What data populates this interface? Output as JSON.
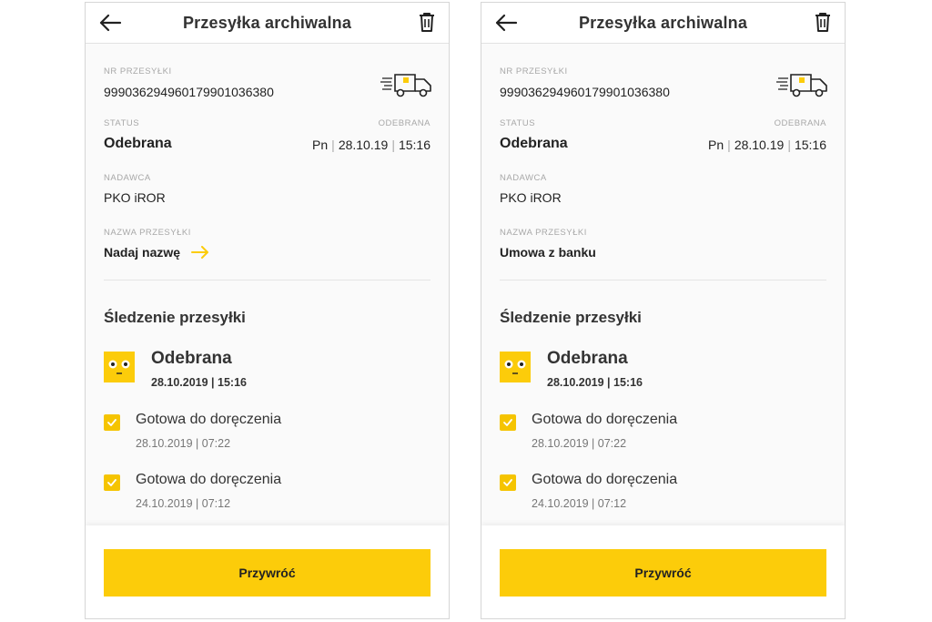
{
  "accent_color": "#fccc0a",
  "icons": [
    "back-arrow-icon",
    "trash-icon",
    "delivery-truck-icon",
    "arrow-right-icon",
    "robot-face-icon",
    "checkbox-check-icon"
  ],
  "screens": [
    {
      "header": {
        "title": "Przesyłka archiwalna"
      },
      "shipment_number": {
        "label": "NR PRZESYŁKI",
        "value": "9990362949601799010363 80"
      },
      "status": {
        "label": "STATUS",
        "value": "Odebrana",
        "right_label": "ODEBRANA",
        "day": "Pn",
        "date": "28.10.19",
        "time": "15:16"
      },
      "sender": {
        "label": "NADAWCA",
        "value": "PKO iROR"
      },
      "shipment_name": {
        "label": "NAZWA PRZESYŁKI",
        "value": "Nadaj nazwę"
      },
      "tracking": {
        "title": "Śledzenie przesyłki",
        "current": {
          "status": "Odebrana",
          "datetime": "28.10.2019 | 15:16"
        },
        "events": [
          {
            "title": "Gotowa do doręczenia",
            "datetime": "28.10.2019 | 07:22"
          },
          {
            "title": "Gotowa do doręczenia",
            "datetime": "24.10.2019 | 07:12"
          }
        ]
      },
      "button": {
        "label": "Przywróć"
      }
    },
    {
      "header": {
        "title": "Przesyłka archiwalna"
      },
      "shipment_number": {
        "label": "NR PRZESYŁKI",
        "value": "999036294960179901036380"
      },
      "status": {
        "label": "STATUS",
        "value": "Odebrana",
        "right_label": "ODEBRANA",
        "day": "Pn",
        "date": "28.10.19",
        "time": "15:16"
      },
      "sender": {
        "label": "NADAWCA",
        "value": "PKO iROR"
      },
      "shipment_name": {
        "label": "NAZWA PRZESYŁKI",
        "value": "Umowa z banku"
      },
      "tracking": {
        "title": "Śledzenie przesyłki",
        "current": {
          "status": "Odebrana",
          "datetime": "28.10.2019 | 15:16"
        },
        "events": [
          {
            "title": "Gotowa do doręczenia",
            "datetime": "28.10.2019 | 07:22"
          },
          {
            "title": "Gotowa do doręczenia",
            "datetime": "24.10.2019 | 07:12"
          }
        ]
      },
      "button": {
        "label": "Przywróć"
      }
    }
  ]
}
